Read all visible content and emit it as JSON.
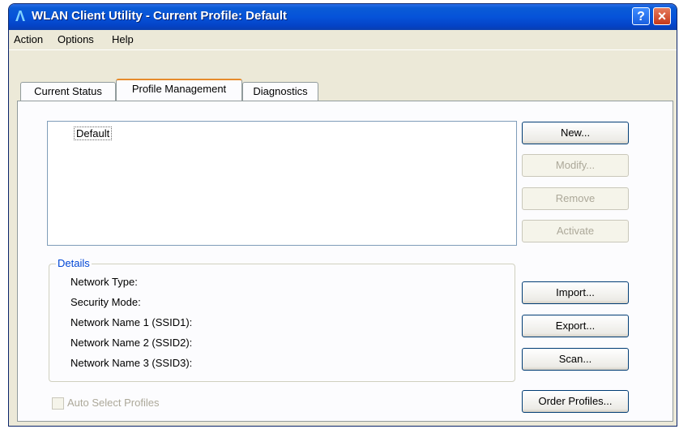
{
  "window": {
    "title": "WLAN Client Utility - Current Profile: Default"
  },
  "menu": [
    "Action",
    "Options",
    "Help"
  ],
  "tabs": [
    {
      "label": "Current Status",
      "active": false
    },
    {
      "label": "Profile Management",
      "active": true
    },
    {
      "label": "Diagnostics",
      "active": false
    }
  ],
  "profiles": [
    "Default"
  ],
  "buttons": {
    "new": "New...",
    "modify": "Modify...",
    "remove": "Remove",
    "activate": "Activate",
    "import": "Import...",
    "export": "Export...",
    "scan": "Scan...",
    "order_profiles": "Order Profiles..."
  },
  "details": {
    "legend": "Details",
    "rows": [
      "Network Type:",
      "Security Mode:",
      "Network Name 1 (SSID1):",
      "Network Name 2 (SSID2):",
      "Network Name 3 (SSID3):"
    ]
  },
  "auto_select": {
    "label": "Auto Select Profiles",
    "checked": false
  },
  "colors": {
    "title_bar": "#0653d9",
    "dialog_bg": "#ece9d8",
    "accent_tab": "#e68b2c",
    "details_legend": "#0046d5"
  },
  "icons": {
    "title": "wlan-a-icon",
    "help": "help-icon",
    "close": "close-icon"
  }
}
